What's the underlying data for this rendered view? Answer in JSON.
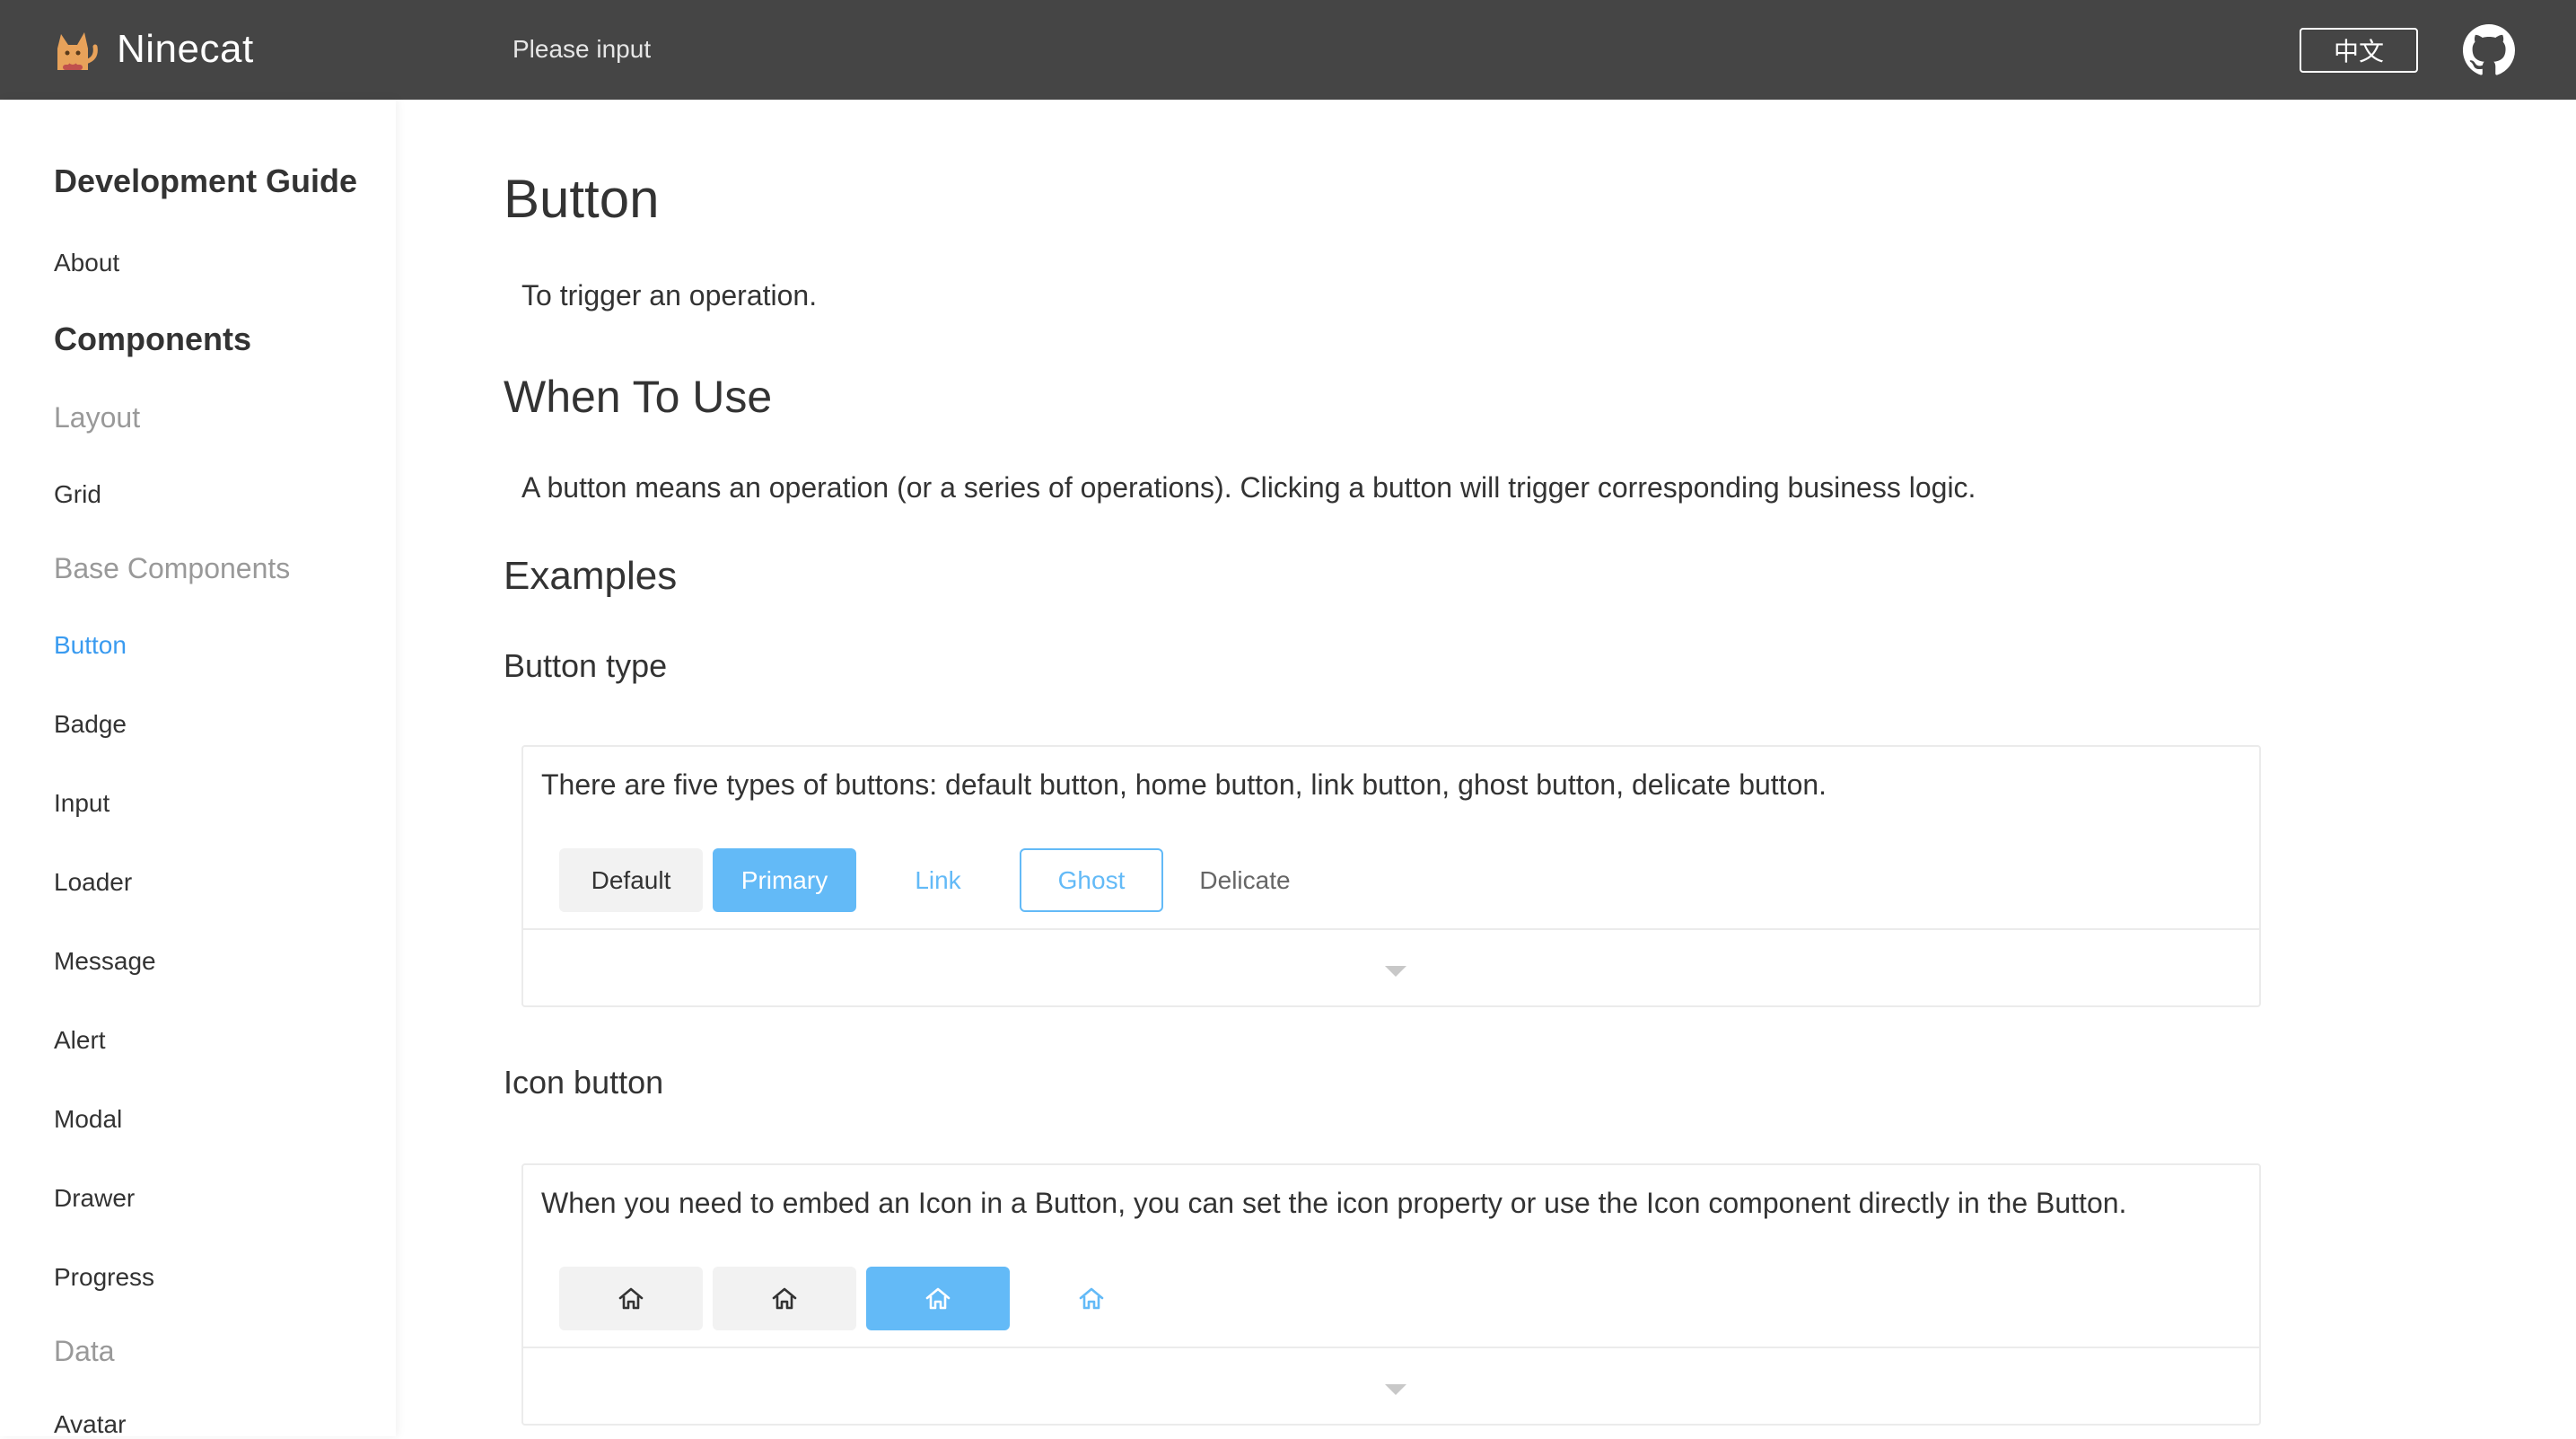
{
  "header": {
    "brand": "Ninecat",
    "search_placeholder": "Please input",
    "language_button": "中文"
  },
  "sidebar": {
    "groups": [
      {
        "label": "Development Guide"
      },
      {
        "label": "Components"
      }
    ],
    "items": {
      "about": "About",
      "layout": "Layout",
      "grid": "Grid",
      "base_components": "Base Components",
      "button": "Button",
      "badge": "Badge",
      "input": "Input",
      "loader": "Loader",
      "message": "Message",
      "alert": "Alert",
      "modal": "Modal",
      "drawer": "Drawer",
      "progress": "Progress",
      "data": "Data",
      "avatar": "Avatar"
    },
    "active_item": "Button"
  },
  "main": {
    "title": "Button",
    "intro": "To trigger an operation.",
    "when_to_use_heading": "When To Use",
    "when_to_use_text": "A button means an operation (or a series of operations). Clicking a button will trigger corresponding business logic.",
    "examples_heading": "Examples",
    "button_type": {
      "heading": "Button type",
      "description": "There are five types of buttons: default button, home button, link button, ghost button, delicate button.",
      "buttons": [
        "Default",
        "Primary",
        "Link",
        "Ghost",
        "Delicate"
      ]
    },
    "icon_button": {
      "heading": "Icon button",
      "description": "When you need to embed an Icon in a Button, you can set the icon property or use the Icon component directly in the Button.",
      "icons": [
        "home-icon",
        "home-icon",
        "home-icon",
        "home-icon"
      ]
    }
  },
  "colors": {
    "header_bg": "#454545",
    "primary": "#63baf7",
    "active_link": "#3a9bf0",
    "muted": "#999999"
  }
}
